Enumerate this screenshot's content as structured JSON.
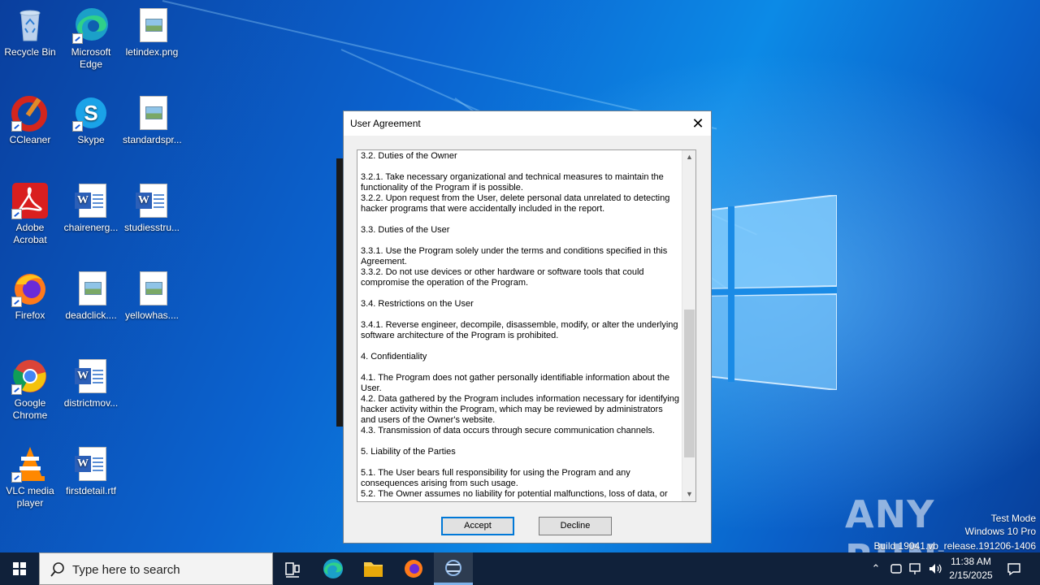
{
  "desktop": {
    "icons": [
      {
        "label": "Recycle Bin"
      },
      {
        "label": "Microsoft Edge"
      },
      {
        "label": "letindex.png"
      },
      {
        "label": "CCleaner"
      },
      {
        "label": "Skype"
      },
      {
        "label": "standardspr..."
      },
      {
        "label": "Adobe Acrobat"
      },
      {
        "label": "chairenerg..."
      },
      {
        "label": "studiesstru..."
      },
      {
        "label": "Firefox"
      },
      {
        "label": "deadclick...."
      },
      {
        "label": "yellowhas...."
      },
      {
        "label": "Google Chrome"
      },
      {
        "label": "districtmov..."
      },
      {
        "label": "VLC media player"
      },
      {
        "label": "firstdetail.rtf"
      }
    ]
  },
  "dialog": {
    "title": "User Agreement",
    "close_icon": "close-icon",
    "agreement_text": " 3.2. Duties of the Owner\n\n3.2.1. Take necessary organizational and technical measures to maintain the functionality of the Program if is possible.\n3.2.2. Upon request from the User, delete personal data unrelated to detecting hacker programs that were accidentally included in the report.\n\n 3.3. Duties of the User\n\n3.3.1. Use the Program solely under the terms and conditions specified in this Agreement.\n3.3.2. Do not use devices or other hardware or software tools that could compromise the operation of the Program.\n\n 3.4. Restrictions on the User\n\n3.4.1. Reverse engineer, decompile, disassemble, modify, or alter the underlying software architecture of the Program is prohibited.\n\n 4. Confidentiality\n\n4.1. The Program does not gather personally identifiable information about the User.\n4.2. Data gathered by the Program includes information necessary for identifying hacker activity within the Program, which may be reviewed by administrators and users of the Owner's website.\n4.3. Transmission of data occurs through secure communication channels.\n\n 5. Liability of the Parties\n\n5.1. The User bears full responsibility for using the Program and any consequences arising from such usage.\n5.2. The Owner assumes no liability for potential malfunctions, loss of data, or",
    "accept_label": "Accept",
    "decline_label": "Decline"
  },
  "watermark": {
    "brand": "ANY RUN",
    "mode": "Test Mode",
    "edition": "Windows 10 Pro",
    "build": "Build 19041.vb_release.191206-1406"
  },
  "taskbar": {
    "search_placeholder": "Type here to search",
    "time": "11:38 AM",
    "date": "2/15/2025"
  },
  "colors": {
    "accent": "#0078d7",
    "taskbar": "#10213a"
  }
}
